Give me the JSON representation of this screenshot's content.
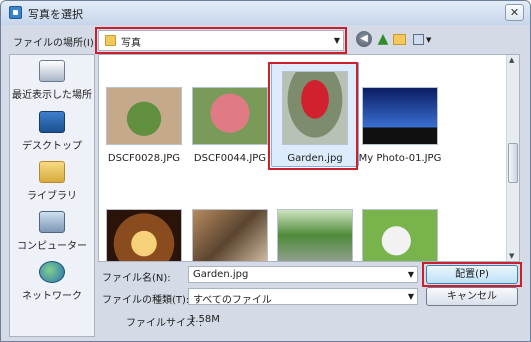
{
  "window": {
    "title": "写真を選択",
    "close": "✕"
  },
  "toolbar": {
    "lookin_label": "ファイルの場所(I):",
    "lookin_value": "写真",
    "back": "◀",
    "up": "▲",
    "view_arrow": "▼"
  },
  "places": [
    {
      "label": "最近表示した場所",
      "icon": "recent-places-icon"
    },
    {
      "label": "デスクトップ",
      "icon": "desktop-icon"
    },
    {
      "label": "ライブラリ",
      "icon": "library-icon"
    },
    {
      "label": "コンピューター",
      "icon": "computer-icon"
    },
    {
      "label": "ネットワーク",
      "icon": "network-icon"
    }
  ],
  "files": [
    {
      "name": "DSCF0028.JPG"
    },
    {
      "name": "DSCF0044.JPG"
    },
    {
      "name": "Garden.jpg",
      "selected": true
    },
    {
      "name": "My Photo-01.JPG"
    },
    {
      "name": ""
    },
    {
      "name": ""
    },
    {
      "name": ""
    },
    {
      "name": ""
    }
  ],
  "form": {
    "filename_label": "ファイル名(N):",
    "filename_value": "Garden.jpg",
    "filetype_label": "ファイルの種類(T):",
    "filetype_value": "すべてのファイル",
    "open_button": "配置(P)",
    "cancel_button": "キャンセル",
    "filesize_label": "ファイルサイズ :",
    "filesize_value": "1.58M"
  },
  "colors": {
    "highlight": "#cc1f2d",
    "selection": "#dcecfc"
  }
}
